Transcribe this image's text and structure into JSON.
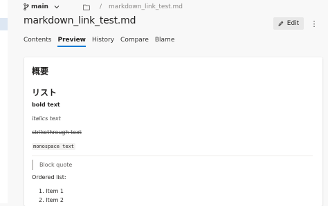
{
  "breadcrumb": {
    "branch_icon": "branch-icon",
    "branch": "main",
    "folder_icon": "folder-icon",
    "separator": "/",
    "file": "markdown_link_test.md"
  },
  "page": {
    "title": "markdown_link_test.md",
    "edit_label": "Edit",
    "more_glyph": "⋮"
  },
  "tabs": [
    {
      "label": "Contents",
      "active": false
    },
    {
      "label": "Preview",
      "active": true
    },
    {
      "label": "History",
      "active": false
    },
    {
      "label": "Compare",
      "active": false
    },
    {
      "label": "Blame",
      "active": false
    }
  ],
  "preview": {
    "h1": "概要",
    "h2": "リスト",
    "bold": "bold text",
    "italic": "italics text",
    "strike": "strikethrough text",
    "mono": "monospace text",
    "quote": "Block quote",
    "ordered_label": "Ordered list:",
    "ordered_items": [
      "1. Item 1",
      "2. Item 2"
    ]
  },
  "colors": {
    "accent": "#0078d4",
    "background": "#f8f8f8"
  }
}
